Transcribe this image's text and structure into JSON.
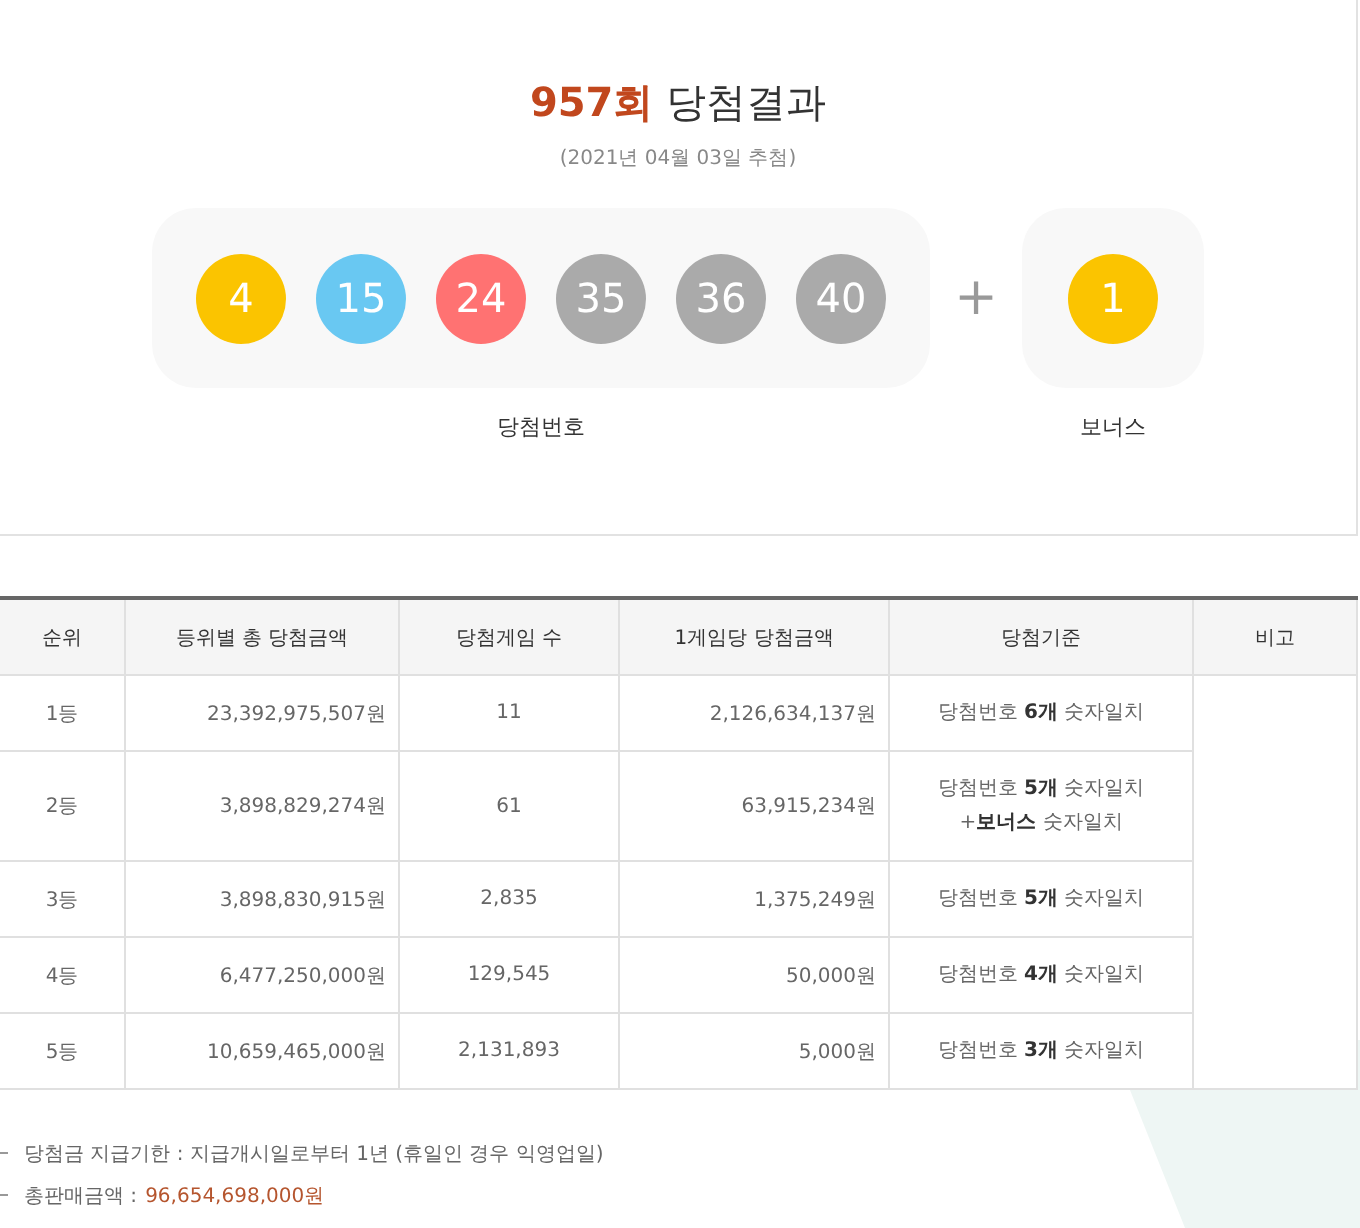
{
  "draw": {
    "round": "957회",
    "title": "당첨결과",
    "date": "(2021년 04월 03일 추첨)",
    "numbers": [
      {
        "value": "4",
        "color": "#fbc400"
      },
      {
        "value": "15",
        "color": "#69c8f2"
      },
      {
        "value": "24",
        "color": "#ff7272"
      },
      {
        "value": "35",
        "color": "#aaaaaa"
      },
      {
        "value": "36",
        "color": "#aaaaaa"
      },
      {
        "value": "40",
        "color": "#aaaaaa"
      }
    ],
    "plus": "+",
    "bonus": {
      "value": "1",
      "color": "#fbc400"
    },
    "numbers_label": "당첨번호",
    "bonus_label": "보너스"
  },
  "table": {
    "columns": [
      "순위",
      "등위별 총 당첨금액",
      "당첨게임 수",
      "1게임당 당첨금액",
      "당첨기준",
      "비고"
    ],
    "rows": [
      {
        "rank": "1등",
        "total": "23,392,975,507원",
        "games": "11",
        "per_game": "2,126,634,137원",
        "criteria": [
          "당첨번호 **6개** 숫자일치"
        ]
      },
      {
        "rank": "2등",
        "total": "3,898,829,274원",
        "games": "61",
        "per_game": "63,915,234원",
        "criteria": [
          "당첨번호 **5개** 숫자일치",
          "+**보너스** 숫자일치"
        ]
      },
      {
        "rank": "3등",
        "total": "3,898,830,915원",
        "games": "2,835",
        "per_game": "1,375,249원",
        "criteria": [
          "당첨번호 **5개** 숫자일치"
        ]
      },
      {
        "rank": "4등",
        "total": "6,477,250,000원",
        "games": "129,545",
        "per_game": "50,000원",
        "criteria": [
          "당첨번호 **4개** 숫자일치"
        ]
      },
      {
        "rank": "5등",
        "total": "10,659,465,000원",
        "games": "2,131,893",
        "per_game": "5,000원",
        "criteria": [
          "당첨번호 **3개** 숫자일치"
        ]
      }
    ]
  },
  "notes": [
    {
      "label": "당첨금 지급기한 : 지급개시일로부터 1년 (휴일인 경우 익영업일)"
    },
    {
      "label": "총판매금액 :",
      "value": "96,654,698,000원"
    }
  ]
}
